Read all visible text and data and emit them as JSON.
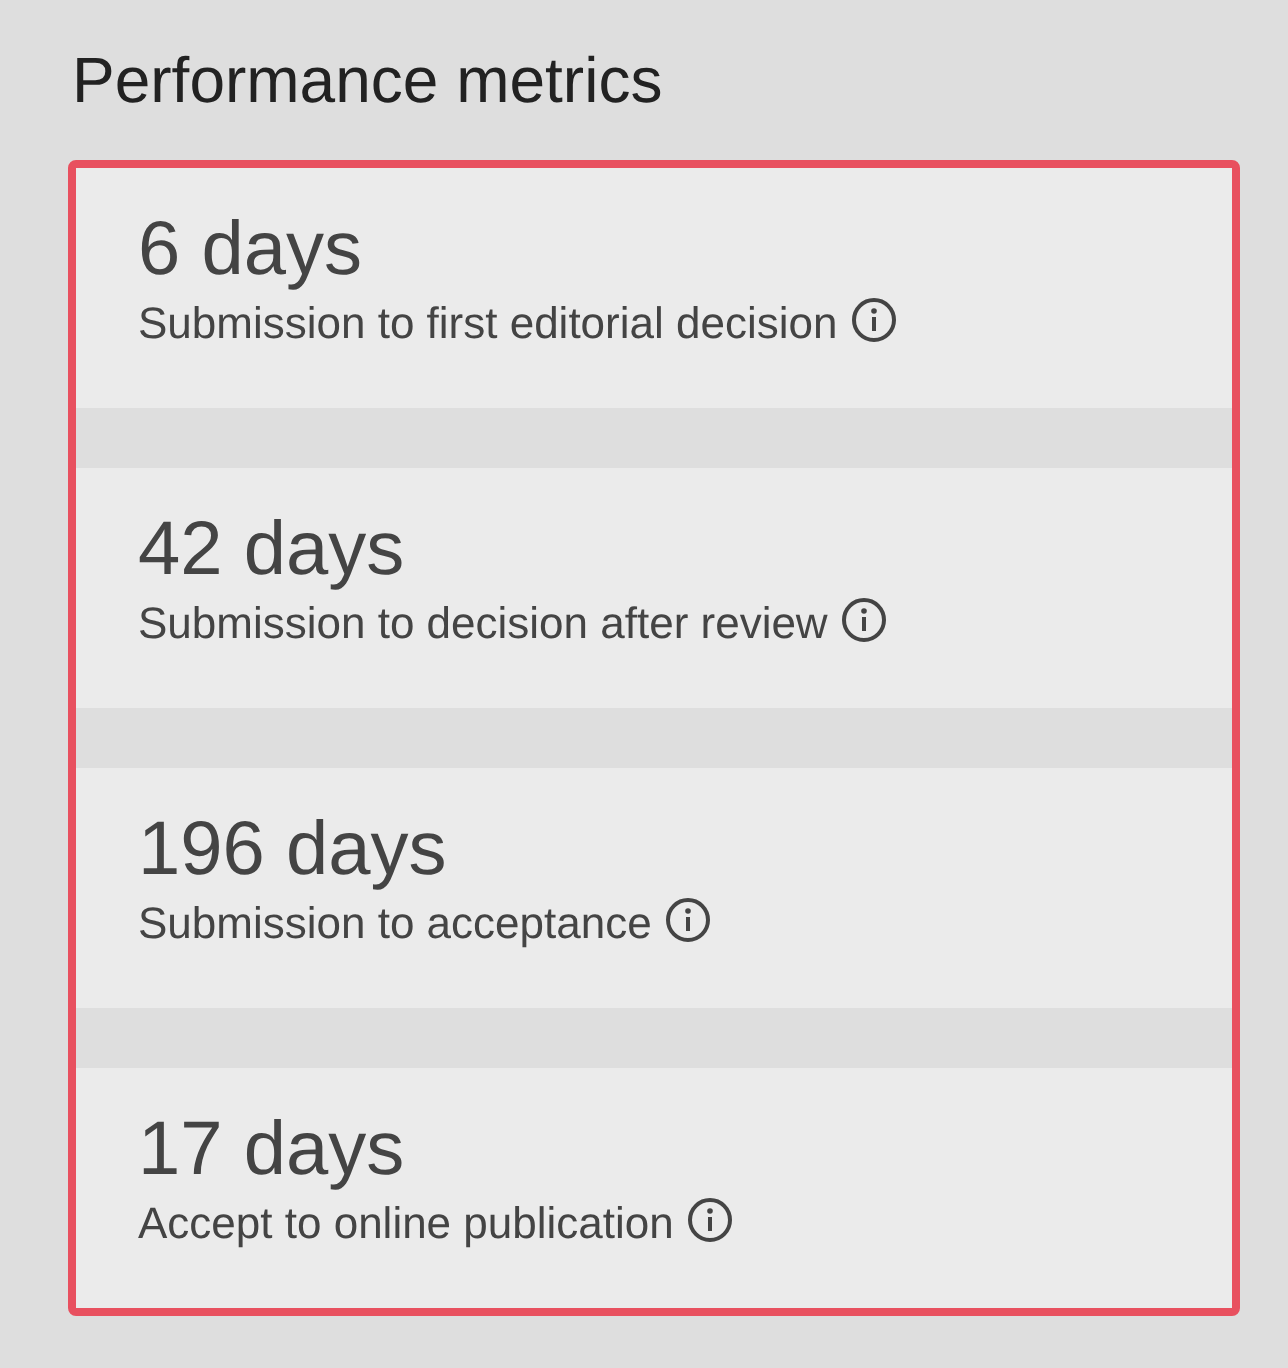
{
  "title": "Performance metrics",
  "metrics": [
    {
      "value": "6 days",
      "label": "Submission to first editorial decision"
    },
    {
      "value": "42 days",
      "label": "Submission to decision after review"
    },
    {
      "value": "196 days",
      "label": "Submission to acceptance"
    },
    {
      "value": "17 days",
      "label": "Accept to online publication"
    }
  ]
}
